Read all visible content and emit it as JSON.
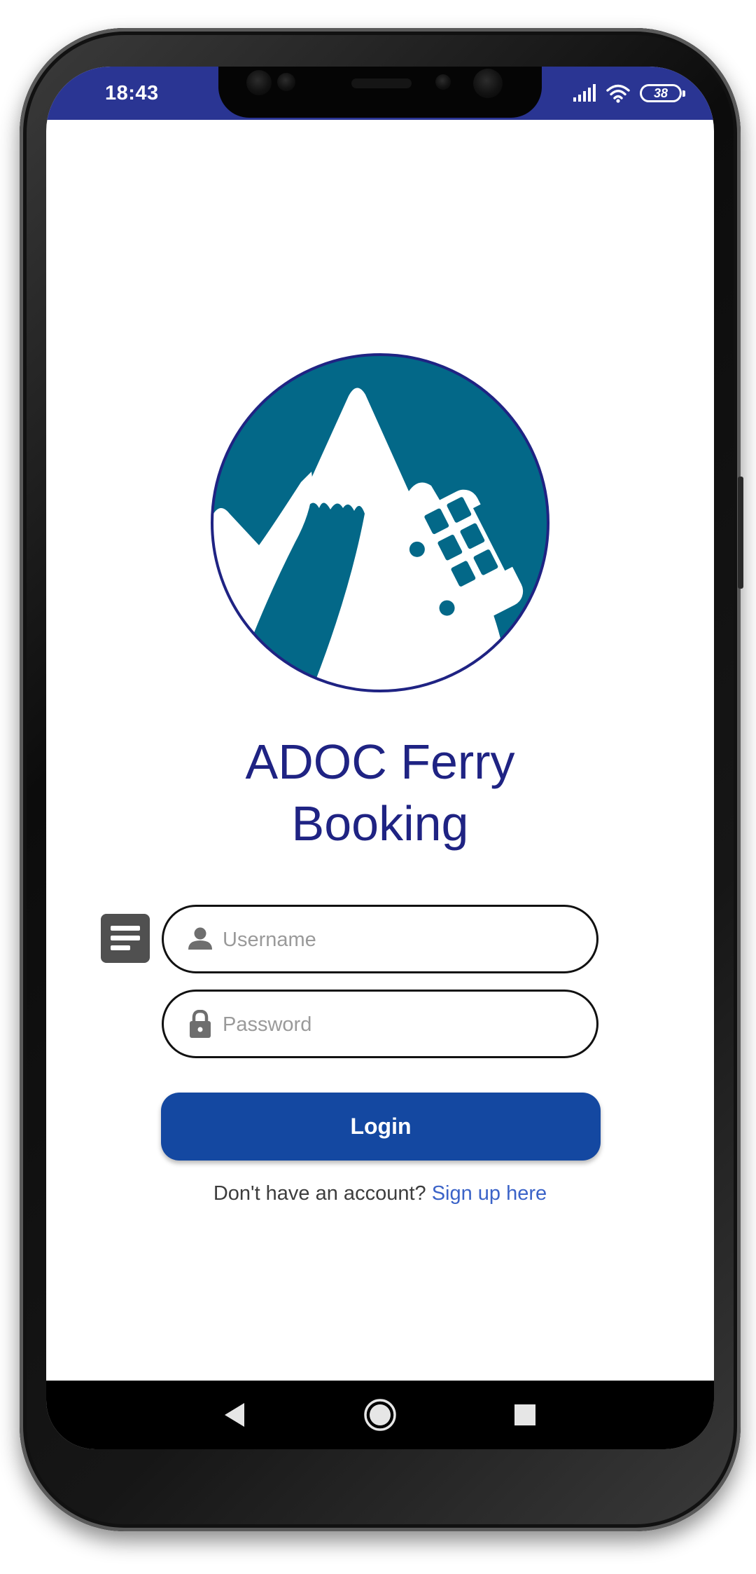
{
  "status_bar": {
    "time": "18:43",
    "battery": "38",
    "icons": [
      "signal-icon",
      "wifi-icon",
      "battery-icon"
    ],
    "color": "#2a3593"
  },
  "app": {
    "title": "ADOC Ferry\nBooking",
    "logo": "mountain-bus-logo",
    "title_color": "#1f2383",
    "logo_color": "#036888"
  },
  "form": {
    "username_placeholder": "Username",
    "password_placeholder": "Password",
    "username_icon": "person-icon",
    "password_icon": "lock-icon",
    "side_icon": "notes-icon"
  },
  "login": {
    "label": "Login",
    "color": "#1448a1"
  },
  "signup": {
    "prompt": "Don't have an account?",
    "link": "Sign up here",
    "link_color": "#3b63c8"
  },
  "nav": {
    "buttons": [
      "back-icon",
      "home-icon",
      "recents-icon"
    ]
  }
}
